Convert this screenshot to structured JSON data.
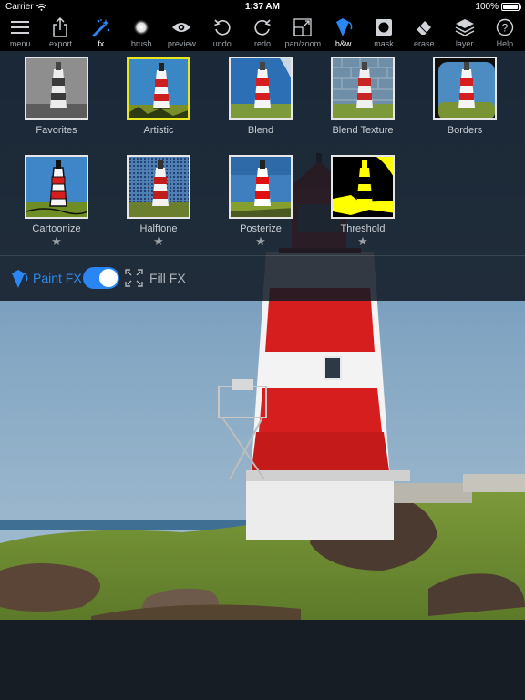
{
  "status": {
    "carrier": "Carrier",
    "time": "1:37 AM",
    "battery": "100%"
  },
  "toolbar": [
    {
      "label": "menu",
      "icon": "menu-icon"
    },
    {
      "label": "export",
      "icon": "export-icon"
    },
    {
      "label": "fx",
      "icon": "magic-wand-icon"
    },
    {
      "label": "brush",
      "icon": "brush-icon"
    },
    {
      "label": "preview",
      "icon": "eye-icon"
    },
    {
      "label": "undo",
      "icon": "undo-icon"
    },
    {
      "label": "redo",
      "icon": "redo-icon"
    },
    {
      "label": "pan/zoom",
      "icon": "pan-zoom-icon"
    },
    {
      "label": "b&w",
      "icon": "bucket-icon"
    },
    {
      "label": "mask",
      "icon": "mask-icon"
    },
    {
      "label": "erase",
      "icon": "eraser-icon"
    },
    {
      "label": "layer",
      "icon": "layers-icon"
    },
    {
      "label": "Help",
      "icon": "help-icon"
    }
  ],
  "fx_row1": [
    {
      "name": "Favorites"
    },
    {
      "name": "Artistic",
      "selected": true
    },
    {
      "name": "Blend"
    },
    {
      "name": "Blend Texture"
    },
    {
      "name": "Borders"
    }
  ],
  "fx_row2": [
    {
      "name": "Cartoonize",
      "star": "★"
    },
    {
      "name": "Halftone",
      "star": "★"
    },
    {
      "name": "Posterize",
      "star": "★"
    },
    {
      "name": "Threshold",
      "star": "★"
    }
  ],
  "paint": {
    "label": "Paint FX",
    "toggle_on": true,
    "fill_label": "Fill FX"
  },
  "colors": {
    "accent": "#2b86f5",
    "selected_border": "#e9e51f",
    "panel": "#121a24"
  }
}
